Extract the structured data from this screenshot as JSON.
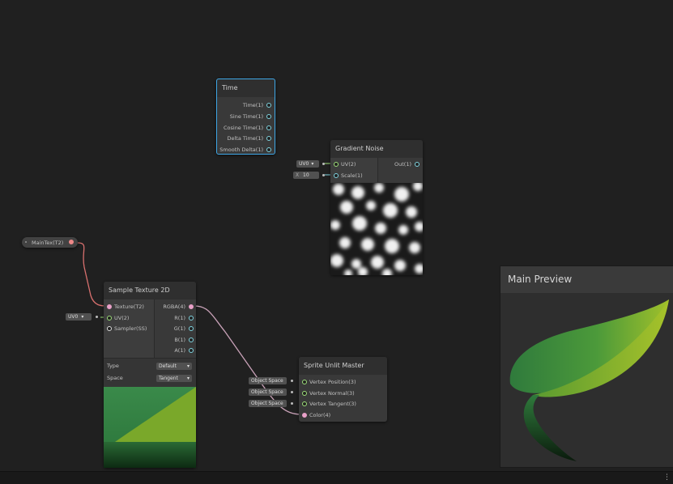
{
  "time_node": {
    "title": "Time",
    "outputs": [
      "Time(1)",
      "Sine Time(1)",
      "Cosine Time(1)",
      "Delta Time(1)",
      "Smooth Delta(1)"
    ]
  },
  "gradient_noise": {
    "title": "Gradient Noise",
    "inputs": [
      "UV(2)",
      "Scale(1)"
    ],
    "output": "Out(1)",
    "uv_field": "UV0",
    "scale_label": "X",
    "scale_value": "10"
  },
  "main_tex": {
    "label": "MainTex(T2)"
  },
  "sample_texture": {
    "title": "Sample Texture 2D",
    "inputs": [
      "Texture(T2)",
      "UV(2)",
      "Sampler(SS)"
    ],
    "outputs": [
      "RGBA(4)",
      "R(1)",
      "G(1)",
      "B(1)",
      "A(1)"
    ],
    "uv_field": "UV0",
    "type_label": "Type",
    "type_value": "Default",
    "space_label": "Space",
    "space_value": "Tangent"
  },
  "sprite_master": {
    "title": "Sprite Unlit Master",
    "inputs": [
      "Vertex Position(3)",
      "Vertex Normal(3)",
      "Vertex Tangent(3)",
      "Color(4)"
    ],
    "space_fields": [
      "Object Space",
      "Object Space",
      "Object Space"
    ]
  },
  "main_preview": {
    "title": "Main Preview"
  },
  "colors": {
    "background": "#202020",
    "selection": "#3fa7e6",
    "link_pink": "#c9a2b8",
    "link_red": "#d8706e"
  }
}
